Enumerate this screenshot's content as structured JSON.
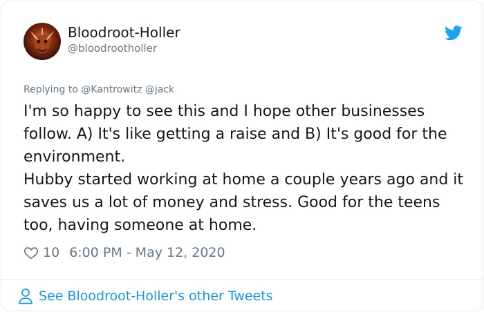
{
  "tweet": {
    "display_name": "Bloodroot-Holler",
    "handle": "@bloodrootholler",
    "replying_to": "Replying to @Kantrowitz @jack",
    "text_paragraph_1": "I'm so happy to see this and I hope other businesses follow. A) It's like getting a raise and B) It's good for the environment.",
    "text_paragraph_2": "Hubby started working at home a couple years ago and it saves us a lot of money and stress. Good for the teens too, having someone at home.",
    "likes": "10",
    "timestamp": "6:00 PM - May 12, 2020",
    "footer_link": "See Bloodroot-Holler's other Tweets"
  },
  "icons": {
    "brand": "twitter-bird-icon",
    "like": "heart-icon",
    "profile": "person-icon"
  },
  "colors": {
    "brand_blue": "#1da1f2",
    "link_blue": "#1b95e0",
    "secondary_text": "#657786",
    "border": "#e1e8ed"
  }
}
